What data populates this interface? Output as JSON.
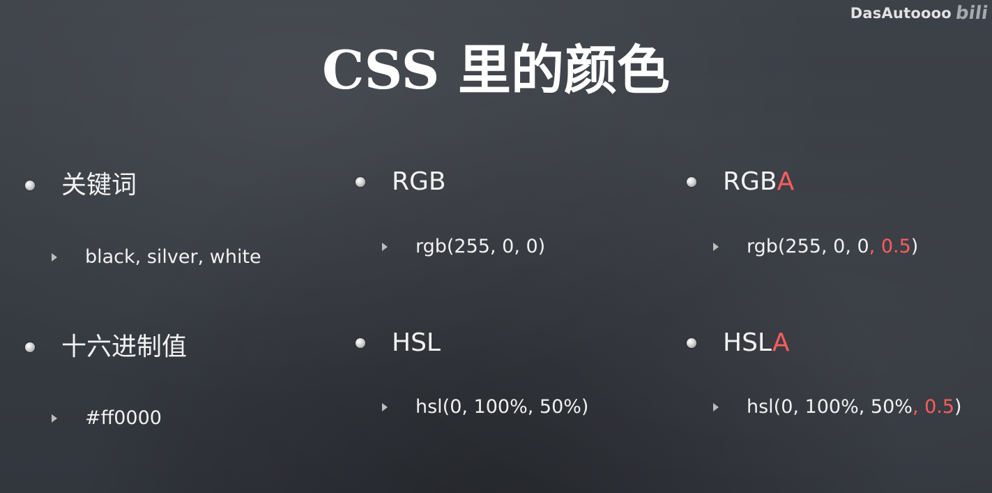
{
  "watermark": {
    "text": "DasAutoooo",
    "logo": "bili"
  },
  "title": "CSS 里的颜色",
  "columns": [
    {
      "items": [
        {
          "heading": "关键词",
          "example": "black, silver, white"
        },
        {
          "heading": "十六进制值",
          "example": "#ff0000"
        }
      ]
    },
    {
      "items": [
        {
          "heading": "RGB",
          "example": "rgb(255, 0, 0)"
        },
        {
          "heading": "HSL",
          "example": "hsl(0, 100%, 50%)"
        }
      ]
    },
    {
      "items": [
        {
          "heading_base": "RGB",
          "heading_accent": "A",
          "example_base": "rgb(255, 0, 0",
          "example_accent": ", 0.5",
          "example_close": ")"
        },
        {
          "heading_base": "HSL",
          "heading_accent": "A",
          "example_base": "hsl(0, 100%, 50%",
          "example_accent": ", 0.5",
          "example_close": ")"
        }
      ]
    }
  ],
  "colors": {
    "accent": "#ff5d5d",
    "text": "#f2f2f2",
    "background": "#3a3e45"
  }
}
